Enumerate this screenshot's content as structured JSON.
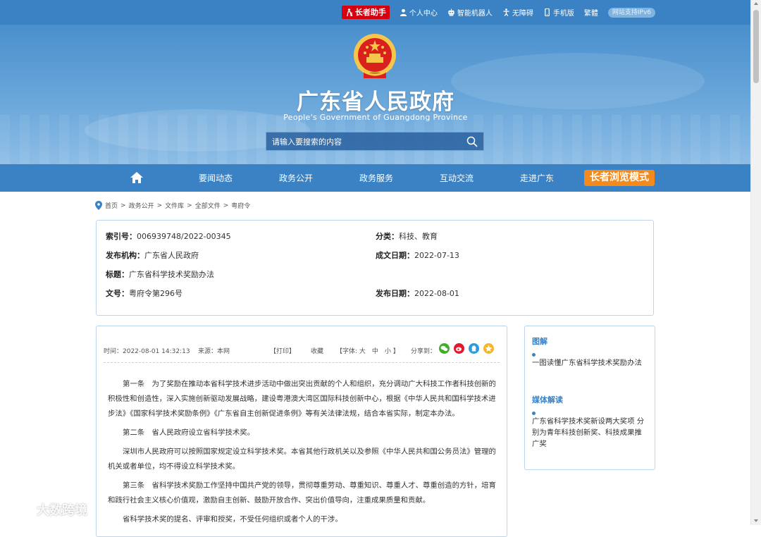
{
  "topbar": {
    "elder_helper": "长者助手",
    "links": [
      {
        "label": "个人中心",
        "icon": "person-icon"
      },
      {
        "label": "智能机器人",
        "icon": "robot-icon"
      },
      {
        "label": "无障碍",
        "icon": "accessibility-icon"
      },
      {
        "label": "手机版",
        "icon": "mobile-icon"
      },
      {
        "label": "繁體",
        "icon": ""
      }
    ],
    "ipv6": "网站支持IPv6"
  },
  "banner": {
    "title": "广东省人民政府",
    "subtitle": "People's Government of Guangdong Province",
    "search_placeholder": "请输入要搜索的内容"
  },
  "nav": {
    "items": [
      "要闻动态",
      "政务公开",
      "政务服务",
      "互动交流",
      "走进广东"
    ],
    "elder_mode": "长者浏览模式"
  },
  "breadcrumb": {
    "items": [
      "首页",
      "政务公开",
      "文件库",
      "全部文件",
      "粤府令"
    ],
    "sep": ">"
  },
  "info": {
    "index_label": "索引号：",
    "index_value": "006939748/2022-00345",
    "category_label": "分类：",
    "category_value": "科技、教育",
    "publisher_label": "发布机构：",
    "publisher_value": "广东省人民政府",
    "created_label": "成文日期：",
    "created_value": "2022-07-13",
    "title_label": "标题：",
    "title_value": "广东省科学技术奖励办法",
    "docno_label": "文号：",
    "docno_value": "粤府令第296号",
    "published_label": "发布日期：",
    "published_value": "2022-08-01"
  },
  "article": {
    "time": "时间：2022-08-01 14:32:13",
    "source": "来源：本网",
    "print": "【打印】",
    "favorite": "收藏",
    "font": "【字体: 大　中　小 】",
    "share": "分享到：",
    "paragraphs": [
      "第一条　为了奖励在推动本省科学技术进步活动中做出突出贡献的个人和组织，充分调动广大科技工作者科技创新的积极性和创造性，深入实施创新驱动发展战略，建设粤港澳大湾区国际科技创新中心，根据《中华人民共和国科学技术进步法》《国家科学技术奖励条例》《广东省自主创新促进条例》等有关法律法规，结合本省实际，制定本办法。",
      "第二条　省人民政府设立省科学技术奖。",
      "深圳市人民政府可以按照国家规定设立科学技术奖。本省其他行政机关以及参照《中华人民共和国公务员法》管理的机关或者单位，均不得设立科学技术奖。",
      "第三条　省科学技术奖励工作坚持中国共产党的领导，贯彻尊重劳动、尊重知识、尊重人才、尊重创造的方针，培育和践行社会主义核心价值观，激励自主创新、鼓励开放合作、突出价值导向，注重成果质量和贡献。",
      "省科学技术奖的提名、评审和授奖，不受任何组织或者个人的干涉。"
    ]
  },
  "sidebar": {
    "section1_title": "图解",
    "section1_link": "一图读懂广东省科学技术奖励办法",
    "section2_title": "媒体解读",
    "section2_link": "广东省科学技术奖新设两大奖项 分别为青年科技创新奖、科技成果推广奖"
  },
  "watermark": "大数跨境",
  "colors": {
    "primary_blue": "#3a82c3",
    "elder_red": "#d7000f",
    "elder_orange": "#f28a1d"
  }
}
